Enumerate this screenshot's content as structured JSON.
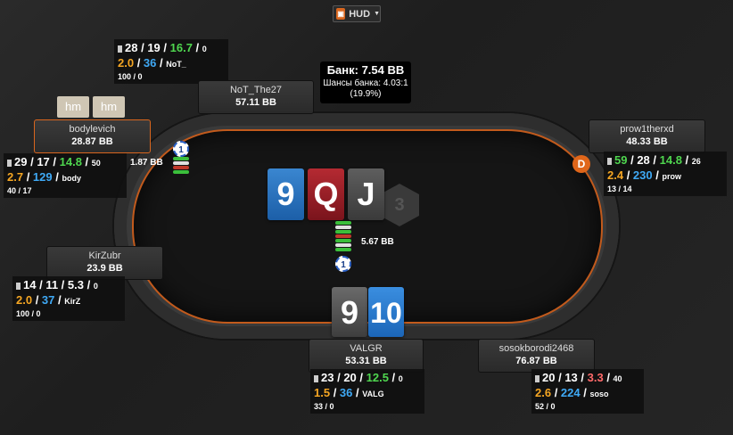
{
  "hud_button": {
    "label": "HUD",
    "logo_icon": "holdem-manager-icon"
  },
  "pot": {
    "main": "Банк: 7.54 BB",
    "odds": "Шансы банка: 4.03:1",
    "pct": "(19.9%)"
  },
  "hm_badges": [
    "hm",
    "hm"
  ],
  "dealer_button": "D",
  "board": [
    {
      "rank": "9",
      "color": "blue"
    },
    {
      "rank": "Q",
      "color": "red"
    },
    {
      "rank": "J",
      "color": "gray"
    }
  ],
  "watermark": "3",
  "hero_cards": [
    {
      "rank": "9",
      "color": "pgray"
    },
    {
      "rank": "10",
      "color": "pblue"
    }
  ],
  "pot_chips": {
    "amount": "5.67 BB",
    "chip_value": "1"
  },
  "bodylevich_bet": {
    "amount": "1.87 BB",
    "chip_value": "1"
  },
  "seats": [
    {
      "id": "not",
      "name": "NoT_The27",
      "stack": "57.11 BB",
      "hud": {
        "vpip": "28",
        "pfr": "19",
        "af": "16.7",
        "af_color": "g",
        "hands": "0",
        "three_bet": "2.0",
        "cbet": "36",
        "tag": "NoT_",
        "extra1": "100",
        "extra2": "0"
      }
    },
    {
      "id": "bodylevich",
      "name": "bodylevich",
      "stack": "28.87 BB",
      "hud": {
        "vpip": "29",
        "pfr": "17",
        "af": "14.8",
        "af_color": "g",
        "hands": "50",
        "three_bet": "2.7",
        "cbet": "129",
        "tag": "body",
        "extra1": "40",
        "extra2": "17"
      }
    },
    {
      "id": "prow",
      "name": "prow1therxd",
      "stack": "48.33 BB",
      "hud": {
        "vpip": "59",
        "pfr": "28",
        "af": "14.8",
        "af_color": "g",
        "hands": "26",
        "three_bet": "2.4",
        "cbet": "230",
        "tag": "prow",
        "extra1": "13",
        "extra2": "14"
      }
    },
    {
      "id": "kirzubr",
      "name": "KirZubr",
      "stack": "23.9 BB",
      "hud": {
        "vpip": "14",
        "pfr": "11",
        "af": "5.3",
        "af_color": "w",
        "hands": "0",
        "three_bet": "2.0",
        "cbet": "37",
        "tag": "KirZ",
        "extra1": "100",
        "extra2": "0"
      }
    },
    {
      "id": "valgr",
      "name": "VALGR",
      "stack": "53.31 BB",
      "hud": {
        "vpip": "23",
        "pfr": "20",
        "af": "12.5",
        "af_color": "g",
        "hands": "0",
        "three_bet": "1.5",
        "cbet": "36",
        "tag": "VALG",
        "extra1": "33",
        "extra2": "0"
      }
    },
    {
      "id": "soso",
      "name": "sosokborodi2468",
      "stack": "76.87 BB",
      "hud": {
        "vpip": "20",
        "pfr": "13",
        "af": "3.3",
        "af_color": "r",
        "hands": "40",
        "three_bet": "2.6",
        "cbet": "224",
        "tag": "soso",
        "extra1": "52",
        "extra2": "0"
      }
    }
  ]
}
